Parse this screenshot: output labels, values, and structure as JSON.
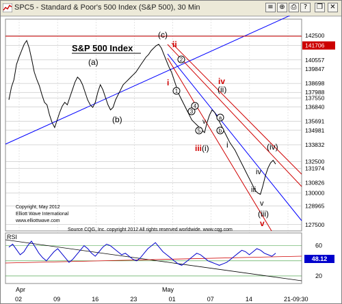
{
  "window": {
    "title": "SPC5 - Standard & Poor's 500 Index (S&P 500), 30 Min",
    "icon": "chart-window-icon",
    "buttons": [
      "menu-icon",
      "zoom-icon",
      "print-icon",
      "help-icon",
      "restore-icon",
      "close-icon"
    ]
  },
  "chart_data": {
    "type": "line",
    "title": "S&P 500 Index",
    "series": [
      {
        "name": "S&P 500",
        "y": [
          13740,
          13840,
          13900,
          14020,
          14080,
          14130,
          14180,
          14210,
          14150,
          14060,
          13960,
          13900,
          13850,
          13780,
          13720,
          13700,
          13620,
          13560,
          13520,
          13580,
          13640,
          13690,
          13720,
          13700,
          13760,
          13820,
          13880,
          13920,
          13900,
          13860,
          13800,
          13740,
          13700,
          13680,
          13720,
          13800,
          13860,
          13820,
          13760,
          13700,
          13660,
          13680,
          13740,
          13780,
          13820,
          13860,
          13880,
          13900,
          13920,
          13940,
          13960,
          13990,
          14020,
          14050,
          14080,
          14100,
          14130,
          14150,
          14170,
          14180,
          14150,
          14100,
          14050,
          14000,
          13960,
          13900,
          13840,
          13780,
          13740,
          13700,
          13660,
          13620,
          13580,
          13560,
          13540,
          13520,
          13500,
          13480,
          13560,
          13620,
          13660,
          13640,
          13600,
          13560,
          13520,
          13480,
          13440,
          13400,
          13370,
          13340,
          13300,
          13260,
          13220,
          13180,
          13140,
          13100,
          13060,
          13020,
          13000,
          12990,
          13060,
          13140,
          13200,
          13240,
          13260,
          13230
        ]
      }
    ],
    "y_ticks": [
      {
        "label": "142500",
        "value": 14250
      },
      {
        "label": "141706",
        "value": 14171,
        "highlight": true
      },
      {
        "label": "140557",
        "value": 14056
      },
      {
        "label": "139847",
        "value": 13985
      },
      {
        "label": "138698",
        "value": 13870
      },
      {
        "label": "137988",
        "value": 13799
      },
      {
        "label": "137550",
        "value": 13755
      },
      {
        "label": "136840",
        "value": 13684
      },
      {
        "label": "135691",
        "value": 13569
      },
      {
        "label": "134981",
        "value": 13498
      },
      {
        "label": "133832",
        "value": 13383
      },
      {
        "label": "132500",
        "value": 13250
      },
      {
        "label": "131974",
        "value": 13197
      },
      {
        "label": "130826",
        "value": 13083
      },
      {
        "label": "130000",
        "value": 13000
      },
      {
        "label": "128965",
        "value": 12897
      },
      {
        "label": "127500",
        "value": 12750
      }
    ],
    "ylim": [
      12700,
      14380
    ],
    "x_ticks": [
      "02",
      "09",
      "16",
      "23",
      "01",
      "07",
      "14",
      "21-09:30"
    ],
    "x_months": [
      "Apr",
      "May"
    ],
    "wave_labels": [
      "(a)",
      "(b)",
      "(c)",
      "ii",
      "i",
      "iii",
      "(i)",
      "iv",
      "(ii)",
      "i",
      "iv",
      "(iv)",
      "iii",
      "v",
      "(iii)",
      "v",
      "v",
      "1",
      "2",
      "3",
      "4",
      "5",
      "a",
      "b"
    ],
    "annotations": [
      "Copyright, May 2012",
      "Elliott Wave International",
      "www.elliottwave.com",
      "Source CQG, Inc. copyright 2012 All rights reserved worldwide. www.cqg.com"
    ]
  },
  "rsi": {
    "label": "RSI",
    "levels": [
      "60",
      "40",
      "20"
    ],
    "current": "48.12",
    "current_value": 48.12,
    "values": [
      58,
      62,
      55,
      48,
      52,
      60,
      66,
      58,
      50,
      44,
      40,
      46,
      52,
      56,
      50,
      44,
      38,
      42,
      48,
      54,
      60,
      56,
      50,
      46,
      52,
      58,
      62,
      60,
      56,
      52,
      48,
      50,
      46,
      42,
      40,
      44,
      50,
      56,
      60,
      64,
      58,
      52,
      48,
      44,
      40,
      36,
      34,
      38,
      42,
      46,
      50,
      48,
      44,
      40,
      38,
      36,
      34,
      36,
      38,
      42,
      46,
      50,
      54,
      52,
      48,
      52,
      56,
      54,
      50,
      48,
      46,
      50
    ]
  },
  "colors": {
    "price": "#000000",
    "wave_red": "#d00000",
    "trend_blue": "#0000ff",
    "rsi": "#0000cc",
    "grid": "#b0b0b0",
    "highlight_bg": "#cc0000"
  }
}
